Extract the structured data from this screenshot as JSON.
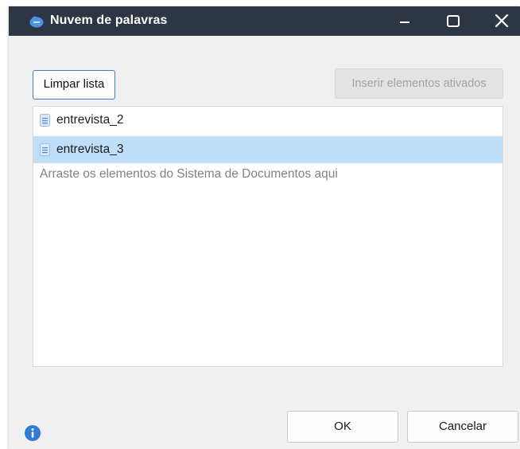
{
  "window": {
    "title": "Nuvem de palavras",
    "icon": "cloud-app-icon",
    "controls": [
      "minimize-icon",
      "maximize-icon",
      "close-icon"
    ]
  },
  "toolbar": {
    "clear_label": "Limpar lista",
    "insert_label": "Inserir elementos ativados"
  },
  "list": {
    "items": [
      {
        "label": "entrevista_2",
        "icon": "document-icon",
        "selected": false
      },
      {
        "label": "entrevista_3",
        "icon": "document-icon",
        "selected": true
      }
    ],
    "hint": "Arraste os elementos do Sistema de Documentos aqui"
  },
  "footer": {
    "ok_label": "OK",
    "cancel_label": "Cancelar",
    "info_icon": "info-icon"
  },
  "colors": {
    "titlebar": "#2e3643",
    "accent": "#3e7dc6",
    "selection": "#bfdefa"
  }
}
